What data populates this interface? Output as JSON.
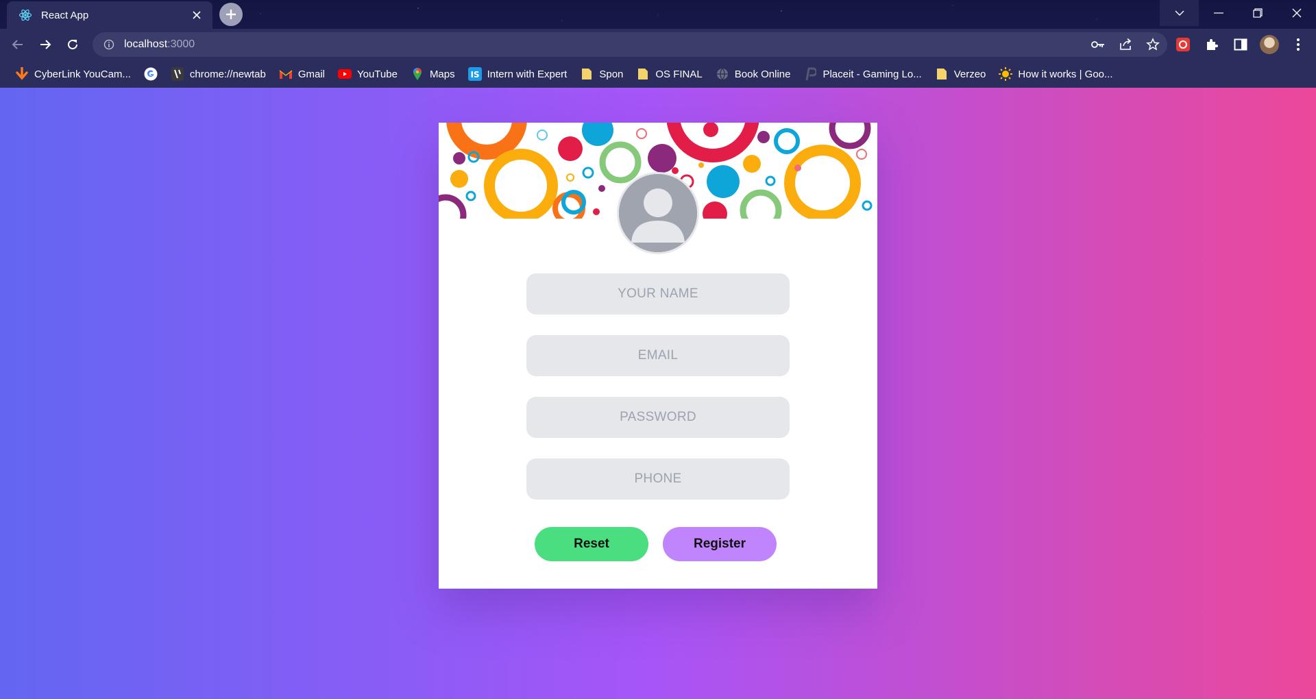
{
  "browser": {
    "tab": {
      "title": "React App"
    },
    "address": {
      "host": "localhost",
      "port": ":3000"
    },
    "bookmarks": [
      {
        "label": "CyberLink YouCam...",
        "icon": "download-arrow-icon"
      },
      {
        "label": "",
        "icon": "google-icon"
      },
      {
        "label": "chrome://newtab",
        "icon": "newtab-icon"
      },
      {
        "label": "Gmail",
        "icon": "gmail-icon"
      },
      {
        "label": "YouTube",
        "icon": "youtube-icon"
      },
      {
        "label": "Maps",
        "icon": "maps-pin-icon"
      },
      {
        "label": "Intern with Expert",
        "icon": "is-logo-icon"
      },
      {
        "label": "Spon",
        "icon": "folder-icon"
      },
      {
        "label": "OS FINAL",
        "icon": "folder-icon"
      },
      {
        "label": "Book Online",
        "icon": "globe-icon"
      },
      {
        "label": "Placeit - Gaming Lo...",
        "icon": "placeit-icon"
      },
      {
        "label": "Verzeo",
        "icon": "folder-icon"
      },
      {
        "label": "How it works | Goo...",
        "icon": "sun-icon"
      }
    ]
  },
  "form": {
    "name_placeholder": "YOUR NAME",
    "email_placeholder": "EMAIL",
    "password_placeholder": "PASSWORD",
    "phone_placeholder": "PHONE",
    "reset_label": "Reset",
    "register_label": "Register"
  },
  "colors": {
    "gradient_start": "#6366f1",
    "gradient_end": "#ec4899",
    "reset_button": "#4ade80",
    "register_button": "#c084fc",
    "field_bg": "#e5e7eb"
  }
}
